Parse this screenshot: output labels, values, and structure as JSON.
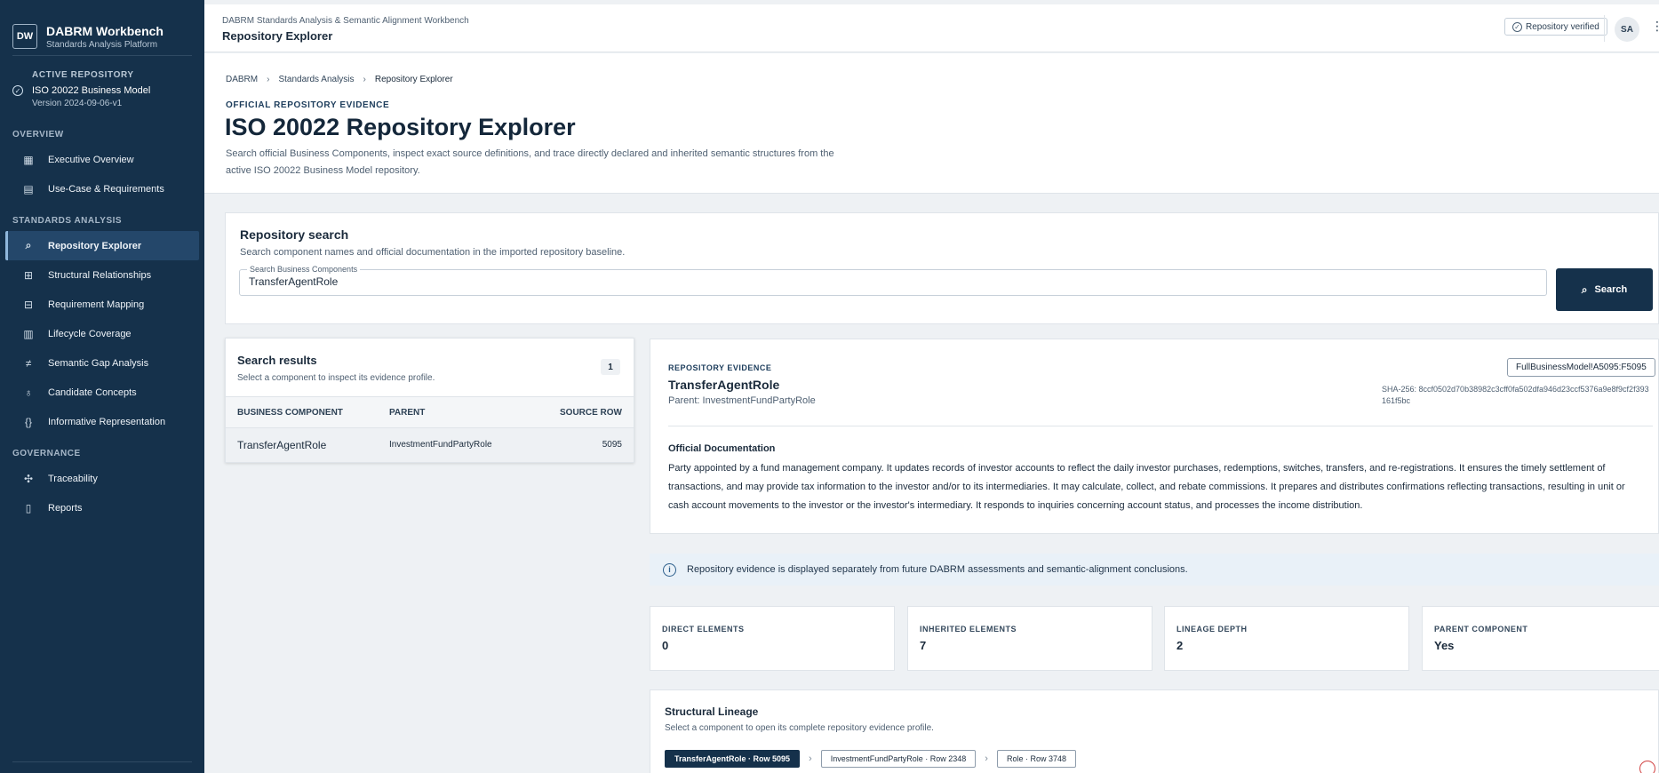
{
  "brand": {
    "logo": "DW",
    "title": "DABRM Workbench",
    "subtitle": "Standards Analysis Platform"
  },
  "active_repository": {
    "label": "ACTIVE REPOSITORY",
    "name": "ISO 20022 Business Model",
    "version": "Version 2024-09-06-v1"
  },
  "nav": {
    "overview_label": "OVERVIEW",
    "overview": [
      {
        "label": "Executive Overview",
        "icon": "dashboard-icon"
      },
      {
        "label": "Use-Case & Requirements",
        "icon": "archive-box-icon"
      }
    ],
    "analysis_label": "STANDARDS ANALYSIS",
    "analysis": [
      {
        "label": "Repository Explorer",
        "icon": "search-icon",
        "active": true
      },
      {
        "label": "Structural Relationships",
        "icon": "hierarchy-icon"
      },
      {
        "label": "Requirement Mapping",
        "icon": "mapping-icon"
      },
      {
        "label": "Lifecycle Coverage",
        "icon": "bar-chart-icon"
      },
      {
        "label": "Semantic Gap Analysis",
        "icon": "gap-icon"
      },
      {
        "label": "Candidate Concepts",
        "icon": "lightbulb-icon"
      },
      {
        "label": "Informative Representation",
        "icon": "code-braces-icon"
      }
    ],
    "governance_label": "GOVERNANCE",
    "governance": [
      {
        "label": "Traceability",
        "icon": "network-icon"
      },
      {
        "label": "Reports",
        "icon": "document-icon"
      }
    ]
  },
  "header": {
    "app": "DABRM Standards Analysis & Semantic Alignment Workbench",
    "title": "Repository Explorer",
    "verified": "Repository verified",
    "avatar": "SA"
  },
  "breadcrumb": [
    "DABRM",
    "Standards Analysis",
    "Repository Explorer"
  ],
  "page": {
    "eyebrow": "OFFICIAL REPOSITORY EVIDENCE",
    "title": "ISO 20022 Repository Explorer",
    "description": "Search official Business Components, inspect exact source definitions, and trace directly declared and inherited semantic structures from the active ISO 20022 Business Model repository."
  },
  "search": {
    "title": "Repository search",
    "subtitle": "Search component names and official documentation in the imported repository baseline.",
    "field_label": "Search Business Components",
    "value": "TransferAgentRole",
    "button": "Search"
  },
  "results": {
    "title": "Search results",
    "subtitle": "Select a component to inspect its evidence profile.",
    "count": "1",
    "columns": [
      "BUSINESS COMPONENT",
      "PARENT",
      "SOURCE ROW"
    ],
    "rows": [
      {
        "component": "TransferAgentRole",
        "parent": "InvestmentFundPartyRole",
        "row": "5095"
      }
    ]
  },
  "evidence": {
    "eyebrow": "REPOSITORY EVIDENCE",
    "name": "TransferAgentRole",
    "parent": "Parent: InvestmentFundPartyRole",
    "ref": "FullBusinessModel!A5095:F5095",
    "sha": "SHA-256: 8ccf0502d70b38982c3cff0fa502dfa946d23ccf5376a9e8f9cf2f393161f5bc",
    "doc_title": "Official Documentation",
    "doc": "Party appointed by a fund management company. It updates records of investor accounts to reflect the daily investor purchases, redemptions, switches, transfers, and re-registrations. It ensures the timely settlement of transactions, and may provide tax information to the investor and/or to its intermediaries. It may calculate, collect, and rebate commissions. It prepares and distributes confirmations reflecting transactions, resulting in unit or cash account movements to the investor or the investor's intermediary. It responds to inquiries concerning account status, and processes the income distribution."
  },
  "info": "Repository evidence is displayed separately from future DABRM assessments and semantic-alignment conclusions.",
  "metrics": [
    {
      "label": "DIRECT ELEMENTS",
      "value": "0"
    },
    {
      "label": "INHERITED ELEMENTS",
      "value": "7"
    },
    {
      "label": "LINEAGE DEPTH",
      "value": "2"
    },
    {
      "label": "PARENT COMPONENT",
      "value": "Yes"
    }
  ],
  "lineage": {
    "title": "Structural Lineage",
    "subtitle": "Select a component to open its complete repository evidence profile.",
    "chain": [
      "TransferAgentRole · Row 5095",
      "InvestmentFundPartyRole · Row 2348",
      "Role · Row 3748"
    ]
  }
}
